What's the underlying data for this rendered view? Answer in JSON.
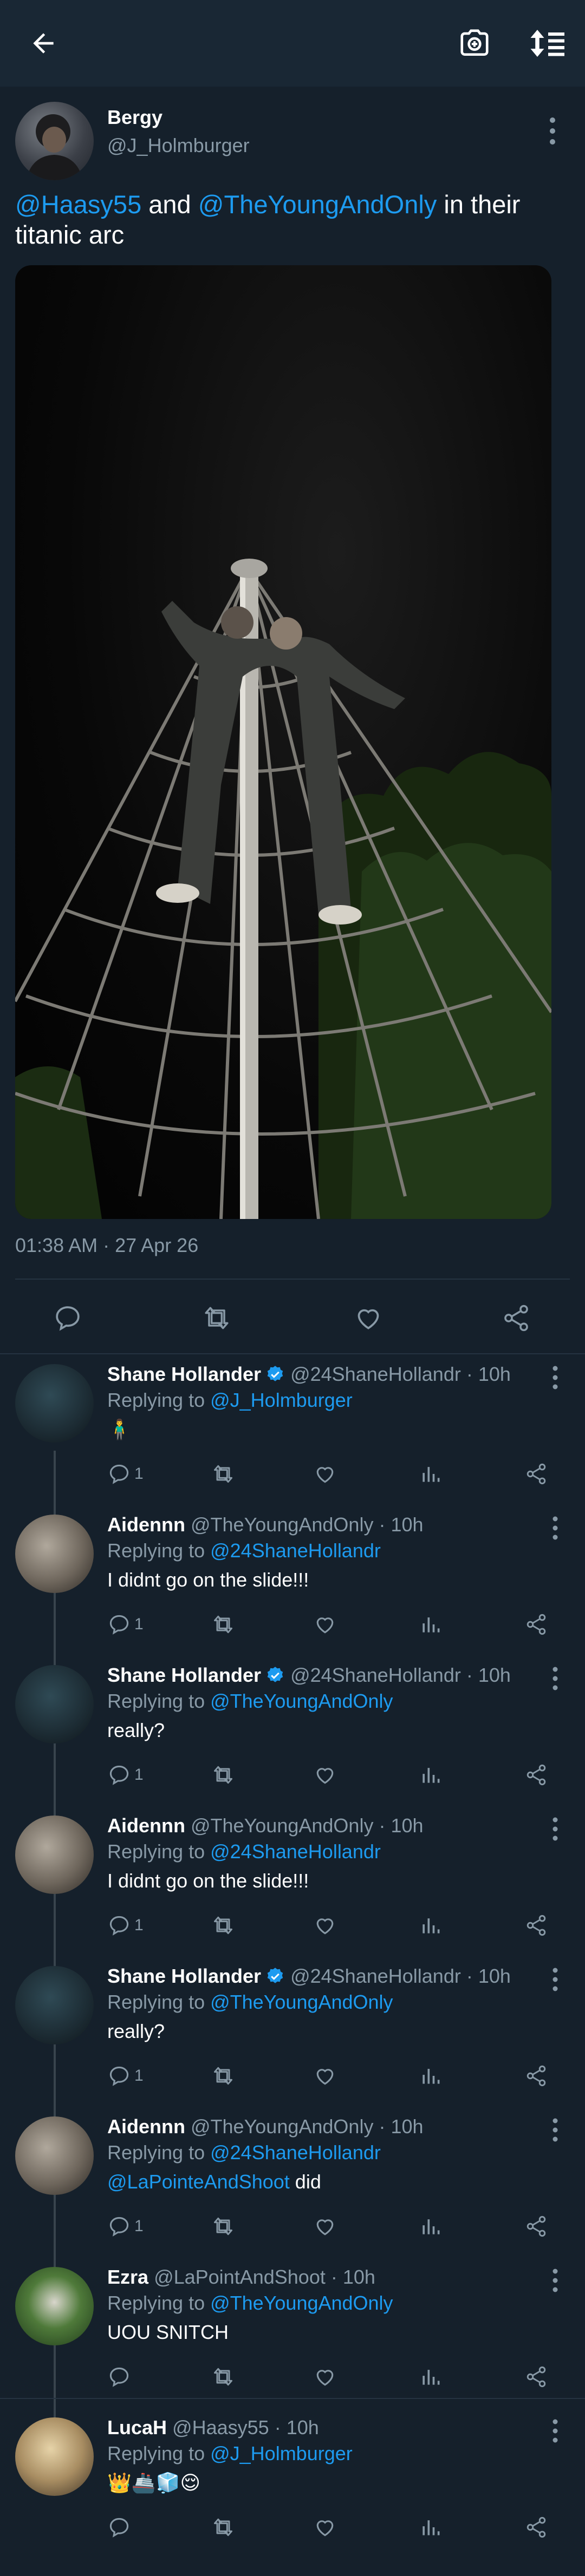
{
  "topbar": {
    "back_icon": "arrow-left-icon",
    "camera_icon": "camera-icon",
    "sort_icon": "sort-icon"
  },
  "main_tweet": {
    "name": "Bergy",
    "handle": "@J_Holmburger",
    "mention1": "@Haasy55",
    "text_and": " and ",
    "mention2": "@TheYoungAndOnly",
    "text_rest": " in their titanic arc",
    "timestamp": "01:38 AM · 27 Apr 26"
  },
  "replies": [
    {
      "name": "Shane Hollander",
      "verified": true,
      "handle": "@24ShaneHollandr",
      "time": "· 10h",
      "replying_prefix": "Replying to ",
      "replying_to": "@J_Holmburger",
      "body": "🧍‍♂️",
      "body_mention": "",
      "reply_count": "1"
    },
    {
      "name": "Aidennn",
      "verified": false,
      "handle": "@TheYoungAndOnly",
      "time": "· 10h",
      "replying_prefix": "Replying to ",
      "replying_to": "@24ShaneHollandr",
      "body": "I didnt go on the slide!!!",
      "body_mention": "",
      "reply_count": "1"
    },
    {
      "name": "Shane Hollander",
      "verified": true,
      "handle": "@24ShaneHollandr",
      "time": "· 10h",
      "replying_prefix": "Replying to ",
      "replying_to": "@TheYoungAndOnly",
      "body": "really?",
      "body_mention": "",
      "reply_count": "1"
    },
    {
      "name": "Aidennn",
      "verified": false,
      "handle": "@TheYoungAndOnly",
      "time": "· 10h",
      "replying_prefix": "Replying to ",
      "replying_to": "@24ShaneHollandr",
      "body": "I didnt go on the slide!!!",
      "body_mention": "",
      "reply_count": "1"
    },
    {
      "name": "Shane Hollander",
      "verified": true,
      "handle": "@24ShaneHollandr",
      "time": "· 10h",
      "replying_prefix": "Replying to ",
      "replying_to": "@TheYoungAndOnly",
      "body": "really?",
      "body_mention": "",
      "reply_count": "1"
    },
    {
      "name": "Aidennn",
      "verified": false,
      "handle": "@TheYoungAndOnly",
      "time": "· 10h",
      "replying_prefix": "Replying to ",
      "replying_to": "@24ShaneHollandr",
      "body": " did",
      "body_mention": "@LaPointeAndShoot",
      "reply_count": "1"
    },
    {
      "name": "Ezra",
      "verified": false,
      "handle": "@LaPointAndShoot",
      "time": "· 10h",
      "replying_prefix": "Replying to ",
      "replying_to": "@TheYoungAndOnly",
      "body": "UOU SNITCH",
      "body_mention": "",
      "reply_count": ""
    },
    {
      "name": "LucaH",
      "verified": false,
      "handle": "@Haasy55",
      "time": "· 10h",
      "replying_prefix": "Replying to ",
      "replying_to": "@J_Holmburger",
      "body": "👑🚢🧊😌",
      "body_mention": "",
      "reply_count": ""
    }
  ],
  "colors": {
    "background": "#15202b",
    "topbar": "#192734",
    "accent": "#1d9bf0",
    "muted": "#8899a6",
    "divider": "#253341"
  }
}
